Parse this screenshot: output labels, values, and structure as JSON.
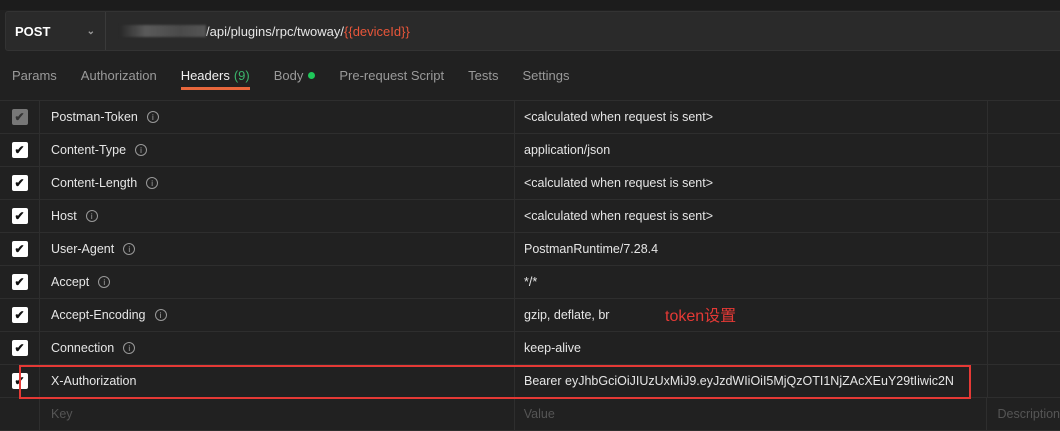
{
  "request": {
    "method": "POST",
    "url_path": "/api/plugins/rpc/twoway/",
    "url_variable": "{{deviceId}}"
  },
  "tabs": [
    {
      "label": "Params"
    },
    {
      "label": "Authorization"
    },
    {
      "label": "Headers",
      "count": "(9)"
    },
    {
      "label": "Body"
    },
    {
      "label": "Pre-request Script"
    },
    {
      "label": "Tests"
    },
    {
      "label": "Settings"
    }
  ],
  "headers": [
    {
      "key": "Postman-Token",
      "value": "<calculated when request is sent>",
      "checked": true,
      "disabled": true,
      "info": true
    },
    {
      "key": "Content-Type",
      "value": "application/json",
      "checked": true,
      "info": true
    },
    {
      "key": "Content-Length",
      "value": "<calculated when request is sent>",
      "checked": true,
      "info": true
    },
    {
      "key": "Host",
      "value": "<calculated when request is sent>",
      "checked": true,
      "info": true
    },
    {
      "key": "User-Agent",
      "value": "PostmanRuntime/7.28.4",
      "checked": true,
      "info": true
    },
    {
      "key": "Accept",
      "value": "*/*",
      "checked": true,
      "info": true
    },
    {
      "key": "Accept-Encoding",
      "value": "gzip, deflate, br",
      "checked": true,
      "info": true
    },
    {
      "key": "Connection",
      "value": "keep-alive",
      "checked": true,
      "info": true
    },
    {
      "key": "X-Authorization",
      "value": "Bearer eyJhbGciOiJIUzUxMiJ9.eyJzdWIiOiI5MjQzOTI1NjZAcXEuY29tIiwic2N",
      "checked": true,
      "info": false
    }
  ],
  "placeholders": {
    "key": "Key",
    "value": "Value",
    "description": "Description"
  },
  "annotation": "token设置",
  "colors": {
    "accent": "#e8673c",
    "highlight": "#e53935",
    "variable": "#e8563a"
  }
}
